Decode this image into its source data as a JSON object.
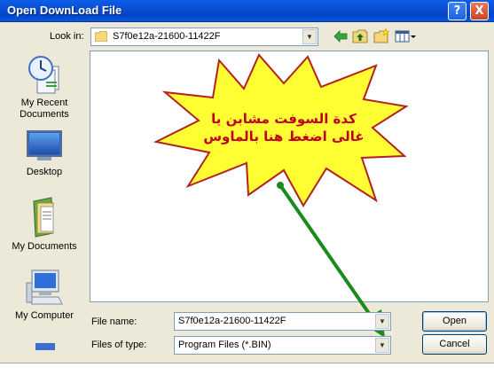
{
  "window": {
    "title": "Open DownLoad File",
    "help_glyph": "?",
    "close_glyph": "X"
  },
  "lookin": {
    "label": "Look in:",
    "value": "S7f0e12a-21600-11422F"
  },
  "places": [
    {
      "label": "My Recent Documents",
      "icon": "recent-documents-icon"
    },
    {
      "label": "Desktop",
      "icon": "desktop-icon"
    },
    {
      "label": "My Documents",
      "icon": "my-documents-icon"
    },
    {
      "label": "My Computer",
      "icon": "my-computer-icon"
    }
  ],
  "annotation": {
    "line1": "كدة السوفت مشابن يا",
    "line2": "غالى اضغط هنا بالماوس",
    "burst_fill": "#ffff33",
    "burst_stroke": "#b22222",
    "text_color": "#c0001a",
    "arrow_color": "#1a8a1a"
  },
  "filename": {
    "label": "File name:",
    "value": "S7f0e12a-21600-11422F"
  },
  "filetype": {
    "label": "Files of type:",
    "value": "Program Files (*.BIN)"
  },
  "buttons": {
    "open": "Open",
    "cancel": "Cancel"
  }
}
